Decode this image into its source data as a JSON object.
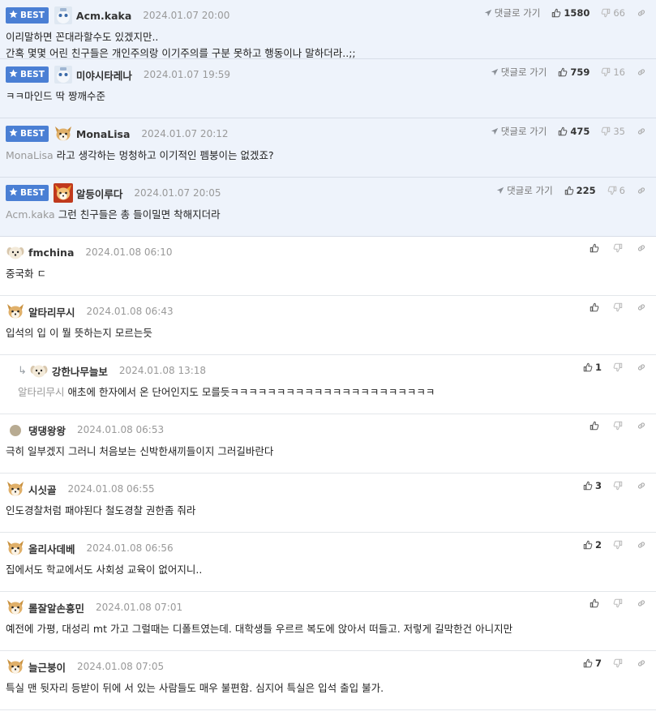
{
  "best_label": "BEST",
  "reply_link_label": "댓글로 가기",
  "comments": [
    {
      "best": true,
      "avatar": "robot",
      "nick": "Acm.kaka",
      "date": "2024.01.07 20:00",
      "mention": "",
      "text": "이리말하면 꼰대라할수도 있겠지만..\n간혹 몇몇 어린 친구들은 개인주의랑 이기주의를 구분 못하고 행동이나 말하더라..;;",
      "up": "1580",
      "down": "66"
    },
    {
      "best": true,
      "avatar": "robot",
      "nick": "미야시타레나",
      "date": "2024.01.07 19:59",
      "mention": "",
      "text": "ㅋㅋ마인드 딱 짱깨수준",
      "up": "759",
      "down": "16"
    },
    {
      "best": true,
      "avatar": "fox",
      "nick": "MonaLisa",
      "date": "2024.01.07 20:12",
      "mention": "MonaLisa",
      "text": "라고 생각하는 멍청하고 이기적인 펨붕이는 없겠죠?",
      "up": "475",
      "down": "35"
    },
    {
      "best": true,
      "avatar": "fire-fox",
      "nick": "알등이루다",
      "date": "2024.01.07 20:05",
      "mention": "Acm.kaka",
      "text": "그런 친구들은 총 들이밀면 착해지더라",
      "up": "225",
      "down": "6"
    },
    {
      "best": false,
      "avatar": "dog",
      "nick": "fmchina",
      "date": "2024.01.08 06:10",
      "mention": "",
      "text": "중국화 ㄷ",
      "up": "",
      "down": ""
    },
    {
      "best": false,
      "avatar": "fox",
      "nick": "알타리무시",
      "date": "2024.01.08 06:43",
      "mention": "",
      "text": "입석의 입 이 뭘 뜻하는지 모르는듯",
      "up": "",
      "down": ""
    },
    {
      "best": false,
      "reply": true,
      "avatar": "dog",
      "nick": "강한나무늘보",
      "date": "2024.01.08 13:18",
      "mention": "알타리무시",
      "text": "애초에 한자에서 온 단어인지도 모를듯ㅋㅋㅋㅋㅋㅋㅋㅋㅋㅋㅋㅋㅋㅋㅋㅋㅋㅋㅋㅋㅋㅋ",
      "up": "1",
      "down": ""
    },
    {
      "best": false,
      "avatar": "circle",
      "nick": "댕댕왕왕",
      "date": "2024.01.08 06:53",
      "mention": "",
      "text": "극히 일부겠지 그러니 처음보는 신박한새끼들이지 그러길바란다",
      "up": "",
      "down": ""
    },
    {
      "best": false,
      "avatar": "fox",
      "nick": "시싯골",
      "date": "2024.01.08 06:55",
      "mention": "",
      "text": "인도경찰처럼 패야된다 철도경찰 권한좀 줘라",
      "up": "3",
      "down": ""
    },
    {
      "best": false,
      "avatar": "fox",
      "nick": "올리사데베",
      "date": "2024.01.08 06:56",
      "mention": "",
      "text": "집에서도 학교에서도 사회성 교육이 없어지니..",
      "up": "2",
      "down": ""
    },
    {
      "best": false,
      "avatar": "fox",
      "nick": "롤잘알손흥민",
      "date": "2024.01.08 07:01",
      "mention": "",
      "text": "예전에 가평, 대성리 mt 가고 그럴때는 디폴트였는데. 대학생들 우르르 복도에 앉아서 떠들고. 저렇게 길막한건 아니지만",
      "up": "",
      "down": ""
    },
    {
      "best": false,
      "avatar": "fox",
      "nick": "늘근붕이",
      "date": "2024.01.08 07:05",
      "mention": "",
      "text": "특실 맨 뒷자리 등받이 뒤에 서 있는 사람들도 매우 불편함. 심지어 특실은 입석 출입 불가.",
      "up": "7",
      "down": ""
    }
  ]
}
